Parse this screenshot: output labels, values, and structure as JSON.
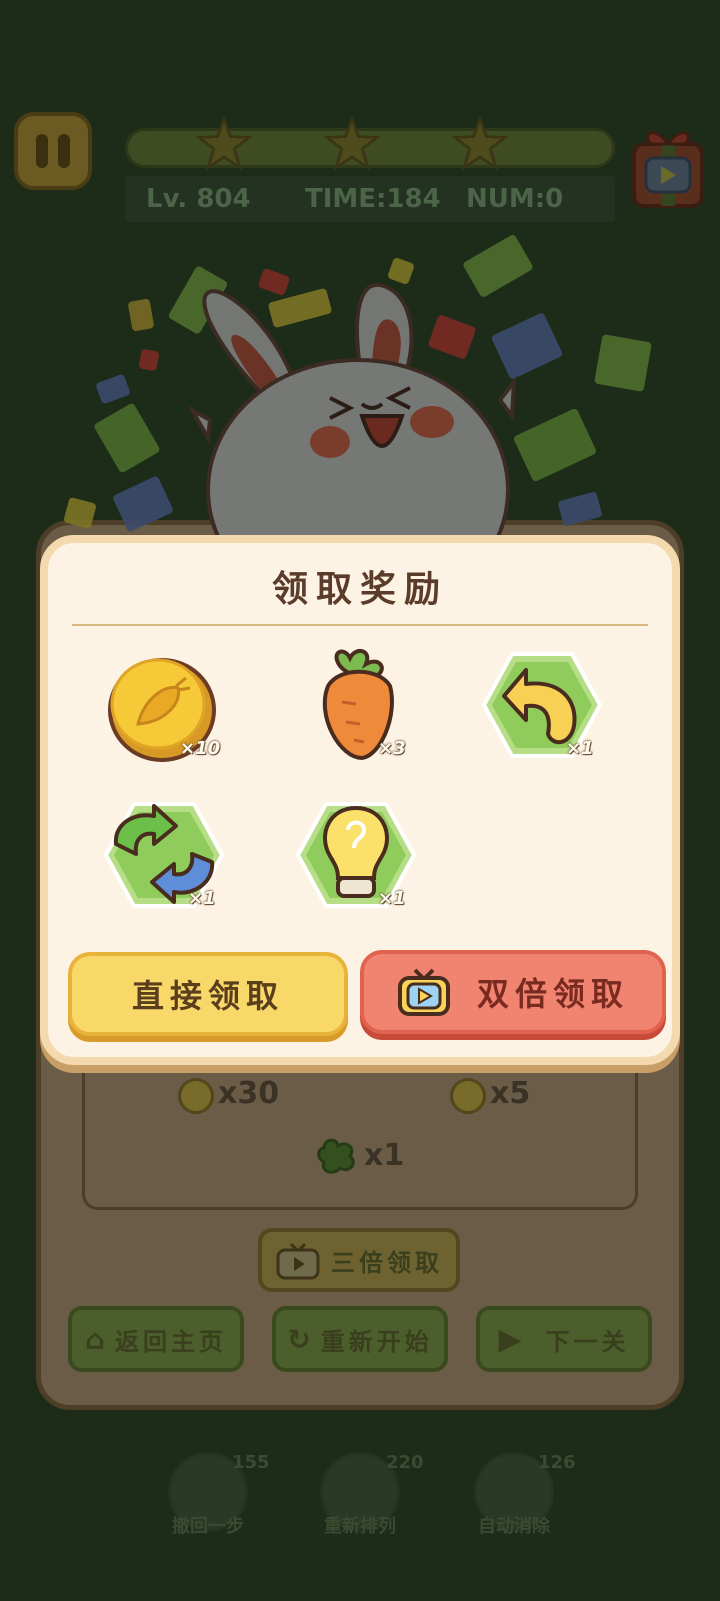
{
  "hud": {
    "level": "Lv. 804",
    "time": "TIME:184",
    "num": "NUM:0",
    "stars": 3
  },
  "modal": {
    "title": "领取奖励",
    "rewards": [
      {
        "icon": "gold-carrot-coin-icon",
        "qty": "×10"
      },
      {
        "icon": "carrot-icon",
        "qty": "×3"
      },
      {
        "icon": "undo-arrow-icon",
        "qty": "×1"
      },
      {
        "icon": "shuffle-icon",
        "qty": "×1"
      },
      {
        "icon": "lightbulb-icon",
        "qty": "×1"
      }
    ],
    "direct_claim": "直接领取",
    "double_claim": "双倍领取"
  },
  "results": {
    "coin_left": "x30",
    "coin_right": "x5",
    "clover": "x1",
    "triple_claim": "三倍领取",
    "home": "返回主页",
    "restart": "重新开始",
    "next": "下一关"
  },
  "tools": [
    {
      "label": "撤回一步",
      "count": "155"
    },
    {
      "label": "重新排列",
      "count": "220"
    },
    {
      "label": "自动消除",
      "count": "126"
    }
  ],
  "colors": {
    "modal_bg": "#fdf3e4",
    "direct_button": "#f9d86a",
    "double_button": "#f18470",
    "overlay": "#1d2b19"
  }
}
